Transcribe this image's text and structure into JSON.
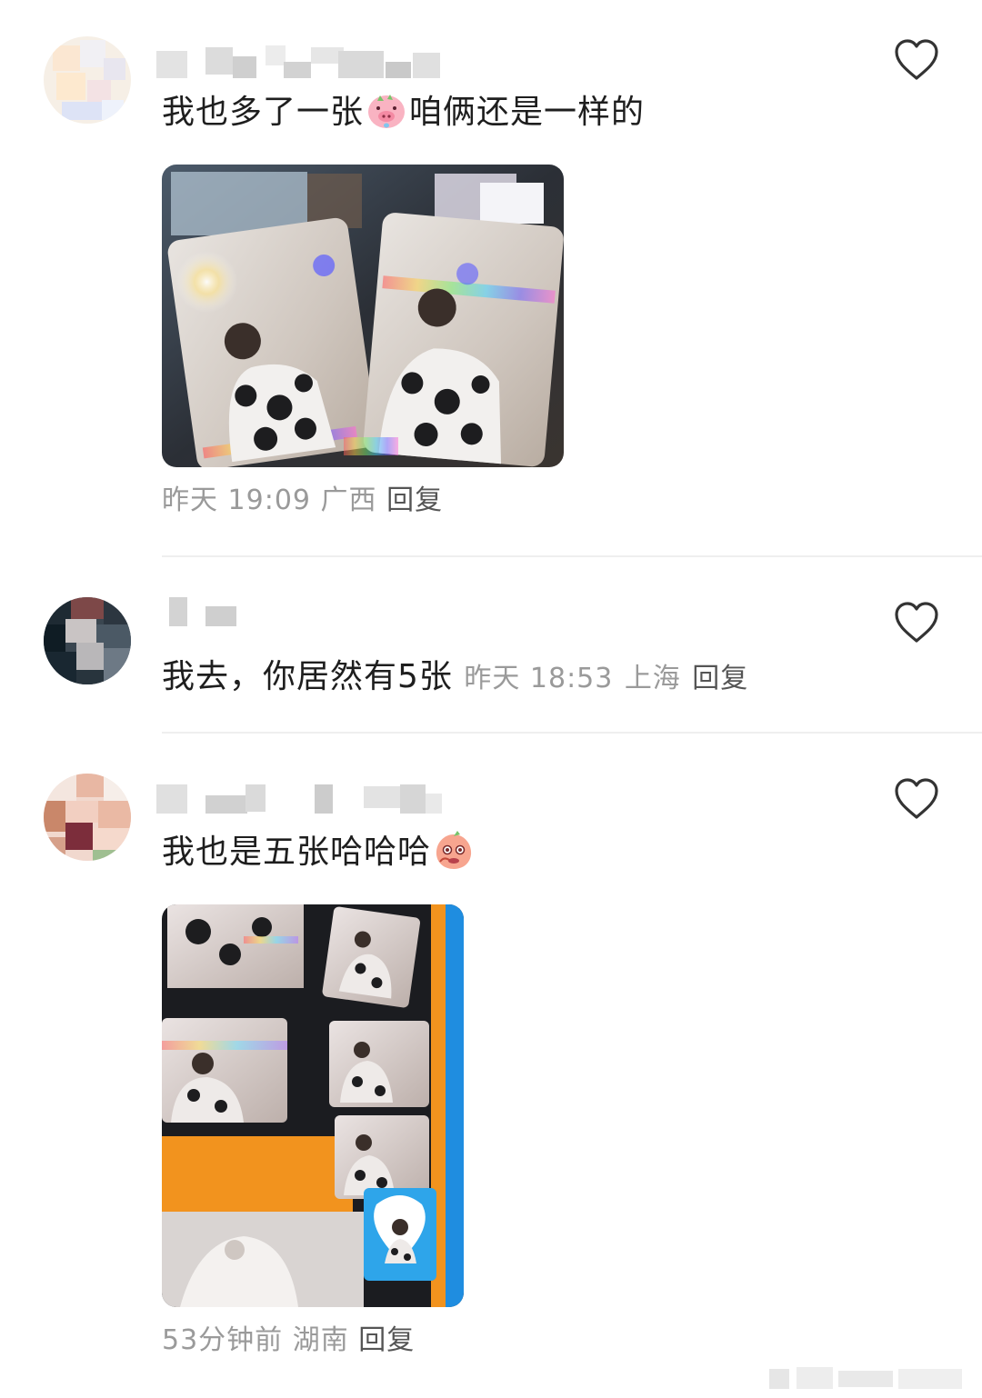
{
  "comments": [
    {
      "text_before": "我也多了一张",
      "emoji_1": "pig-face-emoji",
      "text_after": "咱俩还是一样的",
      "time": "昨天 19:09",
      "location": "广西",
      "reply_label": "回复",
      "has_photo": true
    },
    {
      "text": "我去，你居然有5张",
      "time": "昨天 18:53",
      "location": "上海",
      "reply_label": "回复",
      "has_photo": false
    },
    {
      "text_before": "我也是五张哈哈哈",
      "emoji_1": "peach-drooling-emoji",
      "time": "53分钟前",
      "location": "湖南",
      "reply_label": "回复",
      "has_photo": true
    }
  ],
  "icons": {
    "like": "heart-outline-icon"
  },
  "colors": {
    "text": "#1e1e1e",
    "meta": "#9a9a9a",
    "reply": "#555555",
    "divider": "#efefef"
  }
}
